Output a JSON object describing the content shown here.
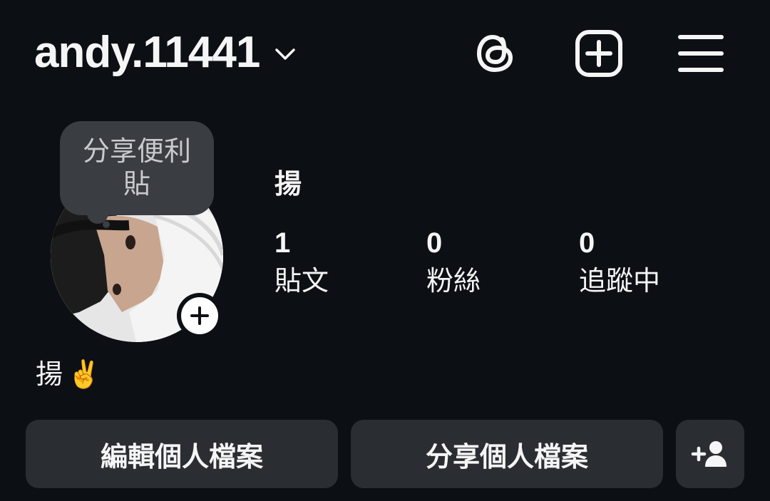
{
  "header": {
    "username": "andy.11441",
    "icons": [
      "chevron-down-icon",
      "threads-icon",
      "add-square-icon",
      "menu-icon"
    ]
  },
  "note": {
    "line1": "分享便利",
    "line2": "貼"
  },
  "profile": {
    "display_name": "揚",
    "bio_text": "揚",
    "bio_emoji": "✌️"
  },
  "stats": {
    "posts": {
      "value": "1",
      "label": "貼文"
    },
    "followers": {
      "value": "0",
      "label": "粉絲"
    },
    "following": {
      "value": "0",
      "label": "追蹤中"
    }
  },
  "actions": {
    "edit_label": "編輯個人檔案",
    "share_label": "分享個人檔案"
  },
  "colors": {
    "background": "#0c0f14",
    "button_bg": "#2a2d32",
    "bubble_bg": "#3a3d42",
    "text": "#f5f5f5"
  }
}
